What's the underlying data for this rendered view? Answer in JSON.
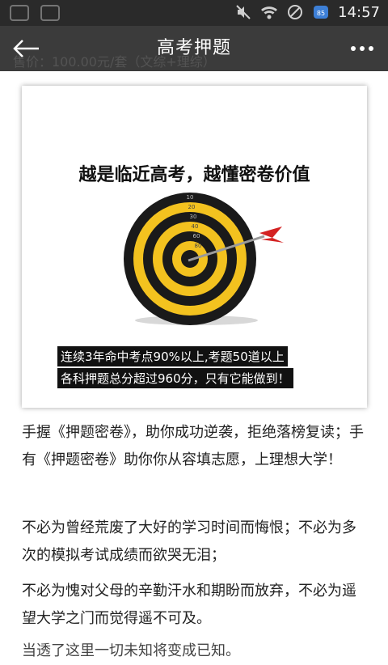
{
  "status_bar": {
    "time": "14:57",
    "battery_level": "85",
    "icons": [
      "mute-icon",
      "wifi-icon",
      "no-signal-icon",
      "notification-icon"
    ]
  },
  "header": {
    "title": "高考押题",
    "behind_text": "售价：100.00元/套（文综+理综）"
  },
  "banner": {
    "headline": "越是临近高考，越懂密卷价值",
    "ring_labels": [
      "10",
      "20",
      "30",
      "40",
      "60",
      "80"
    ],
    "caption_line1": "连续3年命中考点90%以上,考题50道以上",
    "caption_line2": "各科押题总分超过960分，只有它能做到！"
  },
  "content": {
    "paragraphs": [
      "手握《押题密卷》，助你成功逆袭，拒绝落榜复读；手有《押题密卷》助你你从容填志愿，上理想大学！",
      "不必为曾经荒废了大好的学习时间而悔恨；不必为多次的模拟考试成绩而欲哭无泪；",
      "不必为愧对父母的辛勤汗水和期盼而放弃，不必为遥望大学之门而觉得遥不可及。",
      "当透了这里一切未知将变成已知。"
    ]
  },
  "colors": {
    "appbar": "#3b3b3b",
    "status_bar": "#2a2a2a",
    "target_yellow": "#f3c21f",
    "target_black": "#1a1a1a",
    "dart_red": "#d42222"
  }
}
